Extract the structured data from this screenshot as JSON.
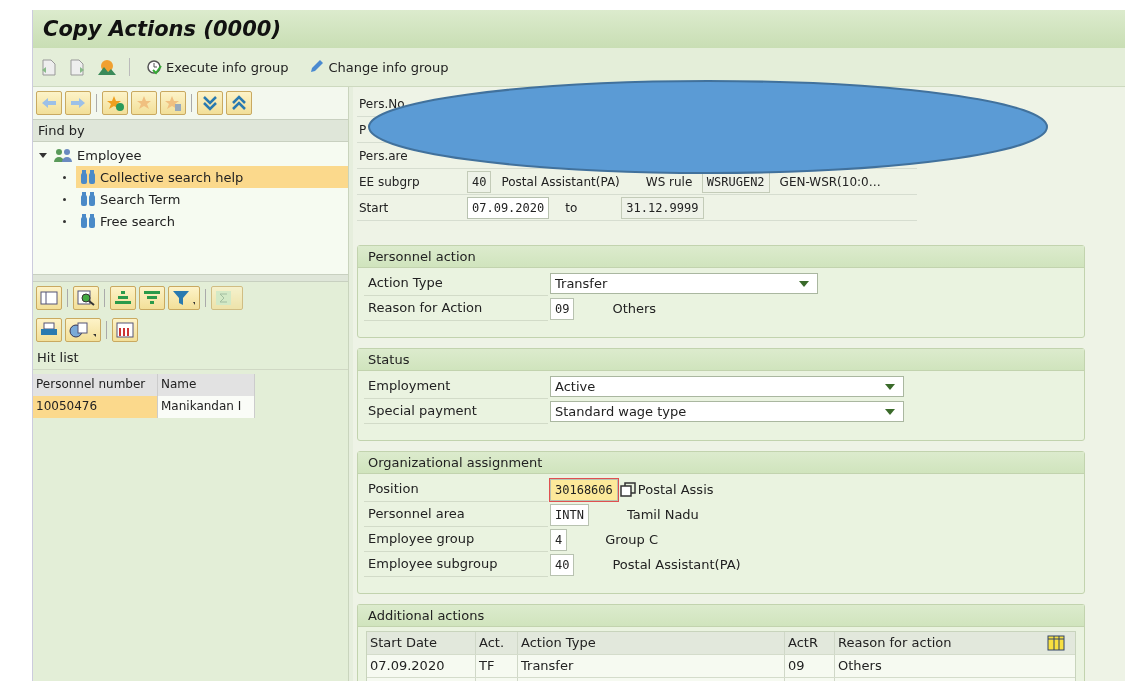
{
  "window": {
    "title": "Copy Actions (0000)"
  },
  "toolbar": [
    {
      "kind": "execute",
      "label": "Execute info group"
    },
    {
      "kind": "pencil",
      "label": "Change info group"
    }
  ],
  "find_by": {
    "title": "Find by",
    "tree": [
      {
        "label": "Employee",
        "expanded": true,
        "children": [
          {
            "label": "Collective search help",
            "selected": true
          },
          {
            "label": "Search Term",
            "selected": false
          },
          {
            "label": "Free search",
            "selected": false
          }
        ]
      }
    ]
  },
  "hit_list": {
    "title": "Hit list",
    "columns": [
      "Personnel number",
      "Name"
    ],
    "rows": [
      {
        "cells": [
          "10050476",
          "Manikandan I"
        ],
        "selected": true
      }
    ]
  },
  "header": [
    {
      "label": "Pers.No"
    },
    {
      "label": "P"
    },
    {
      "label": "Pers.are"
    },
    {
      "label": "EE subgrp",
      "code": "40",
      "editable": false,
      "text": "Postal Assistant(PA)",
      "label2": "WS rule",
      "code2": "WSRUGEN2",
      "text2": "GEN-WSR(10:0…"
    },
    {
      "label": "Start",
      "code": "07.09.2020",
      "editable": true,
      "label2": "to",
      "code2": "31.12.9999"
    }
  ],
  "sections": [
    {
      "title": "Personnel action",
      "fields": [
        {
          "label": "Action Type",
          "kind": "dropdown",
          "value": "Transfer"
        },
        {
          "label": "Reason for Action",
          "kind": "code",
          "value": "09",
          "text": "Others"
        }
      ]
    },
    {
      "title": "Status",
      "fields": [
        {
          "label": "Employment",
          "kind": "dropdown",
          "value": "Active"
        },
        {
          "label": "Special payment",
          "kind": "dropdown",
          "value": "Standard wage type"
        }
      ]
    },
    {
      "title": "Organizational assignment",
      "fields": [
        {
          "label": "Position",
          "kind": "code",
          "value": "30168606",
          "focused": true,
          "text": "Postal Assis"
        },
        {
          "label": "Personnel area",
          "kind": "code",
          "value": "INTN",
          "text": "Tamil Nadu"
        },
        {
          "label": "Employee group",
          "kind": "code",
          "value": "4",
          "text": "Group C"
        },
        {
          "label": "Employee subgroup",
          "kind": "code",
          "value": "40",
          "text": "Postal Assistant(PA)"
        }
      ]
    }
  ],
  "additional_actions": {
    "title": "Additional actions",
    "columns": [
      "Start Date",
      "Act.",
      "Action Type",
      "ActR",
      "Reason for action"
    ],
    "rows": [
      {
        "cells": [
          "07.09.2020",
          "TF",
          "Transfer",
          "09",
          "Others"
        ]
      }
    ]
  }
}
